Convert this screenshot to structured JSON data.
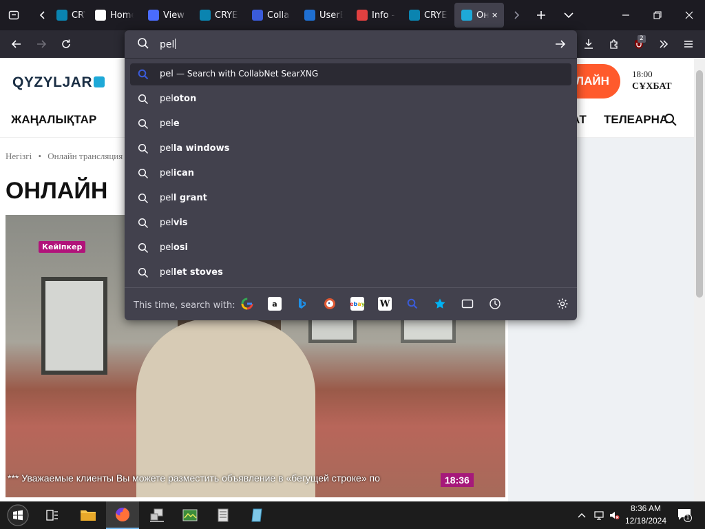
{
  "browser": {
    "tabs": [
      {
        "label": "CRYE",
        "icon": "cryengine-icon",
        "favcolor": "#0a84b0"
      },
      {
        "label": "Home",
        "icon": "home-favicon",
        "favcolor": "#ffffff"
      },
      {
        "label": "View",
        "icon": "at-sign-icon",
        "favcolor": "#4a6cff"
      },
      {
        "label": "CRYE",
        "icon": "cryengine-icon",
        "favcolor": "#0a84b0"
      },
      {
        "label": "Colla",
        "icon": "search-favicon",
        "favcolor": "#3a5bd9"
      },
      {
        "label": "UserB",
        "icon": "w-favicon",
        "favcolor": "#1f6fd1"
      },
      {
        "label": "Info -",
        "icon": "info-favicon",
        "favcolor": "#e04040"
      },
      {
        "label": "CRYE",
        "icon": "cryengine-icon",
        "favcolor": "#0a84b0"
      },
      {
        "label": "Он",
        "icon": "qyzyljar-favicon",
        "favcolor": "#1ea9d8",
        "active": true
      }
    ],
    "extension_badge": "2"
  },
  "urlbar": {
    "typed": "pel",
    "heuristic": {
      "prefix": "pel",
      "suffix": "— Search with CollabNet SearXNG"
    },
    "suggestions": [
      {
        "typed": "pel",
        "completion": "oton"
      },
      {
        "typed": "pel",
        "completion": "e"
      },
      {
        "typed": "pel",
        "completion": "la windows"
      },
      {
        "typed": "pel",
        "completion": "ican"
      },
      {
        "typed": "pel",
        "completion": "l grant"
      },
      {
        "typed": "pel",
        "completion": "vis"
      },
      {
        "typed": "pel",
        "completion": "osi"
      },
      {
        "typed": "pel",
        "completion": "let stoves"
      }
    ],
    "oneoff_label": "This time, search with:",
    "engines": [
      "google-icon",
      "amazon-icon",
      "bing-icon",
      "duckduckgo-icon",
      "ebay-icon",
      "wikipedia-icon",
      "searxng-icon",
      "bookmarks-icon",
      "tabs-icon",
      "history-icon"
    ]
  },
  "site": {
    "logo": "QYZYLJAR",
    "live_button": "ЛАЙН",
    "schedule_time": "18:00",
    "schedule_show": "СҰХБАТ",
    "nav": [
      "ЖАҢАЛЫҚТАР",
      "АТ",
      "ТЕЛЕАРНА"
    ],
    "breadcrumb_home": "Негізгі",
    "breadcrumb_current": "Онлайн трансляция",
    "title": "ОНЛАЙН",
    "video_badge": "Кейіпкер",
    "video_ticker": "*** Уважаемые клиенты Вы можете разместить объявление в «бегущей строке» по",
    "video_clock": "18:36"
  },
  "taskbar": {
    "time": "8:36 AM",
    "date": "12/18/2024",
    "notification_count": "1"
  }
}
